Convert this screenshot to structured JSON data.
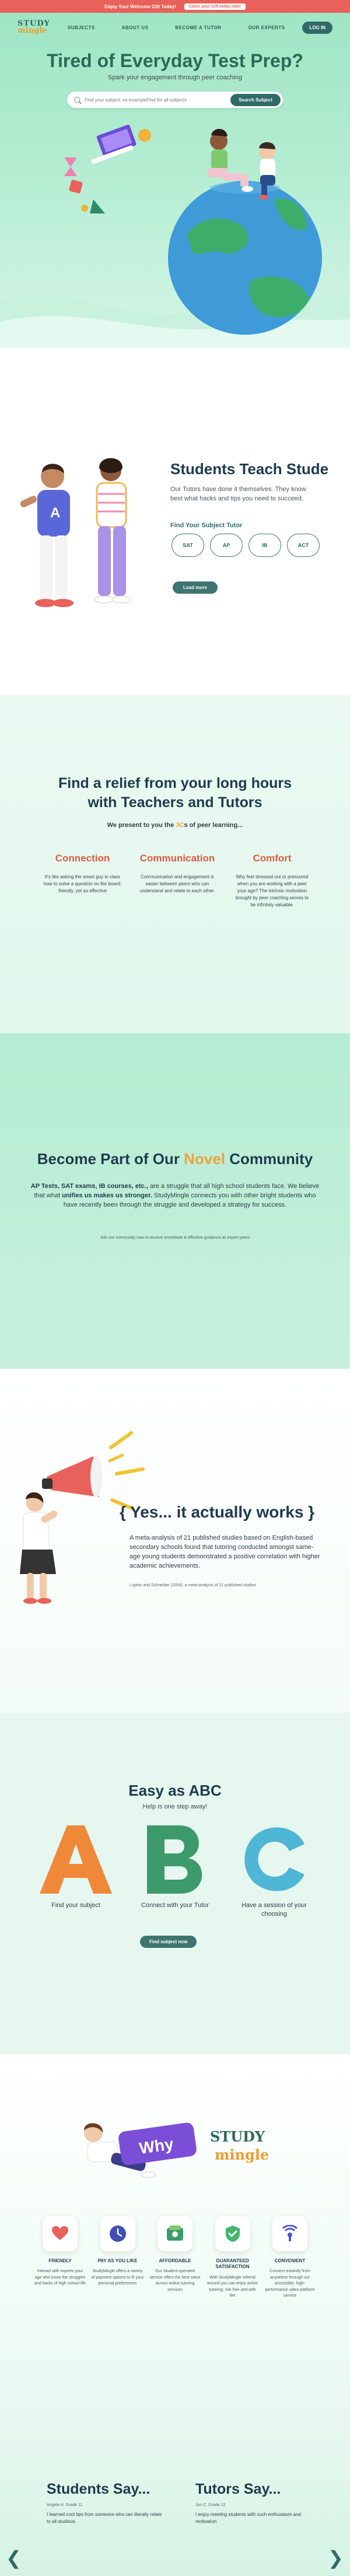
{
  "promo": {
    "text": "Enjoy Your Welcome Gift Today!",
    "button": "Claim your Gift today now!"
  },
  "nav": {
    "logo_top": "STUDY",
    "logo_bottom": "mingle",
    "links": [
      "SUBJECTS",
      "ABOUT US",
      "BECOME A TUTOR",
      "OUR EXPERTS"
    ],
    "login": "LOG IN"
  },
  "hero": {
    "title": "Tired of Everyday Test Prep?",
    "subtitle": "Spark your engagement through peer coaching",
    "search_placeholder": "Find your subject, ex:exampleFind for all subjects",
    "search_button": "Search Subject"
  },
  "teach": {
    "title": "Students Teach Stude",
    "text": "Our Tutors have done it themselves. They know best what hacks and tips you need to succeed.",
    "find_label": "Find Your Subject Tutor",
    "pills": [
      "SAT",
      "AP",
      "IB",
      "ACT"
    ],
    "more_button": "Load more"
  },
  "relief": {
    "title_line1": "Find a relief from your long hours",
    "title_line2": "with Teachers and Tutors",
    "sub_before": "We present to you the ",
    "sub_highlight": "3C",
    "sub_after": "s of peer learning...",
    "cards": [
      {
        "title": "Connection",
        "body": "It's like asking the smart guy in class how to solve a question on the board; friendly, yet so effective"
      },
      {
        "title": "Communication",
        "body": "Communication and engagement is easier between peers who can understand and relate to each other."
      },
      {
        "title": "Comfort",
        "body": "Why feel stressed out or pressured when you are working with a peer your age? The intrinsic motivation brought by peer coaching serves to be infinitely valuable."
      }
    ]
  },
  "novel": {
    "title_before": "Become Part of Our ",
    "title_highlight": "Novel",
    "title_after": " Community",
    "bold1": "AP Tests, SAT exams, IB courses, etc.,",
    "text1": " are a struggle that all high school students face. We believe that what ",
    "bold2": "unifies us makes us stronger.",
    "text2": " StudyMingle connects you with other bright students who have recently been through the struggle and developed a strategy for success.",
    "small": "Join our community now to receive immediate & effective guidance as expert peers"
  },
  "works": {
    "title": "{ Yes... it actually works }",
    "text": "A meta-analysis of 21 published studies based on English-based secondary schools found that tutoring conducted amongst same-age young students demonstrated a positive correlation with higher academic achievements.",
    "cite": "Lupton and Schneider (2004): a meta-analysis of 21 published studies"
  },
  "abc": {
    "title": "Easy as ABC",
    "subtitle": "Help is one step away!",
    "steps": [
      {
        "letter": "A",
        "caption": "Find your subject",
        "color": "#f0883a"
      },
      {
        "letter": "B",
        "caption": "Connect with your Tutor",
        "color": "#3c9a6b"
      },
      {
        "letter": "C",
        "caption": "Have a session of your choosing",
        "color": "#4fb6d6"
      }
    ],
    "button": "Find subject now"
  },
  "why": {
    "banner": "Why",
    "logo_top": "STUDY",
    "logo_bottom": "mingle",
    "features": [
      {
        "title": "FRIENDLY",
        "body": "Interact with experts your age who know the struggles and hacks of high school life",
        "icon": "heart-icon",
        "color": "#e8615a"
      },
      {
        "title": "PAY AS YOU LIKE",
        "body": "StudyMingle offers a variety of payment options to fit your personal preferences",
        "icon": "clock-icon",
        "color": "#3f4fb6"
      },
      {
        "title": "AFFORDABLE",
        "body": "Our Student-operated service offers the best value across online tutoring services",
        "icon": "cash-icon",
        "color": "#3c9a6b"
      },
      {
        "title": "GUARANTEED SATISFACTION",
        "body": "With StudyMingle referral around you can enjoy active tutoring; risk free and with fee",
        "icon": "check-badge-icon",
        "color": "#42b56a"
      },
      {
        "title": "CONVENIENT",
        "body": "Connect instantly from anywhere through our accessible, high-performance video platform service",
        "icon": "signal-icon",
        "color": "#4a58c8"
      }
    ]
  },
  "testimonials": {
    "students_title": "Students Say...",
    "students_meta": "Angela H. Grade 11",
    "students_body": "I learned cool tips from someone who can literally relate to all studious",
    "tutors_title": "Tutors Say...",
    "tutors_meta": "Jun C. Grade 12",
    "tutors_body": "I enjoy meeting students with such enthusiasm and motivation"
  }
}
